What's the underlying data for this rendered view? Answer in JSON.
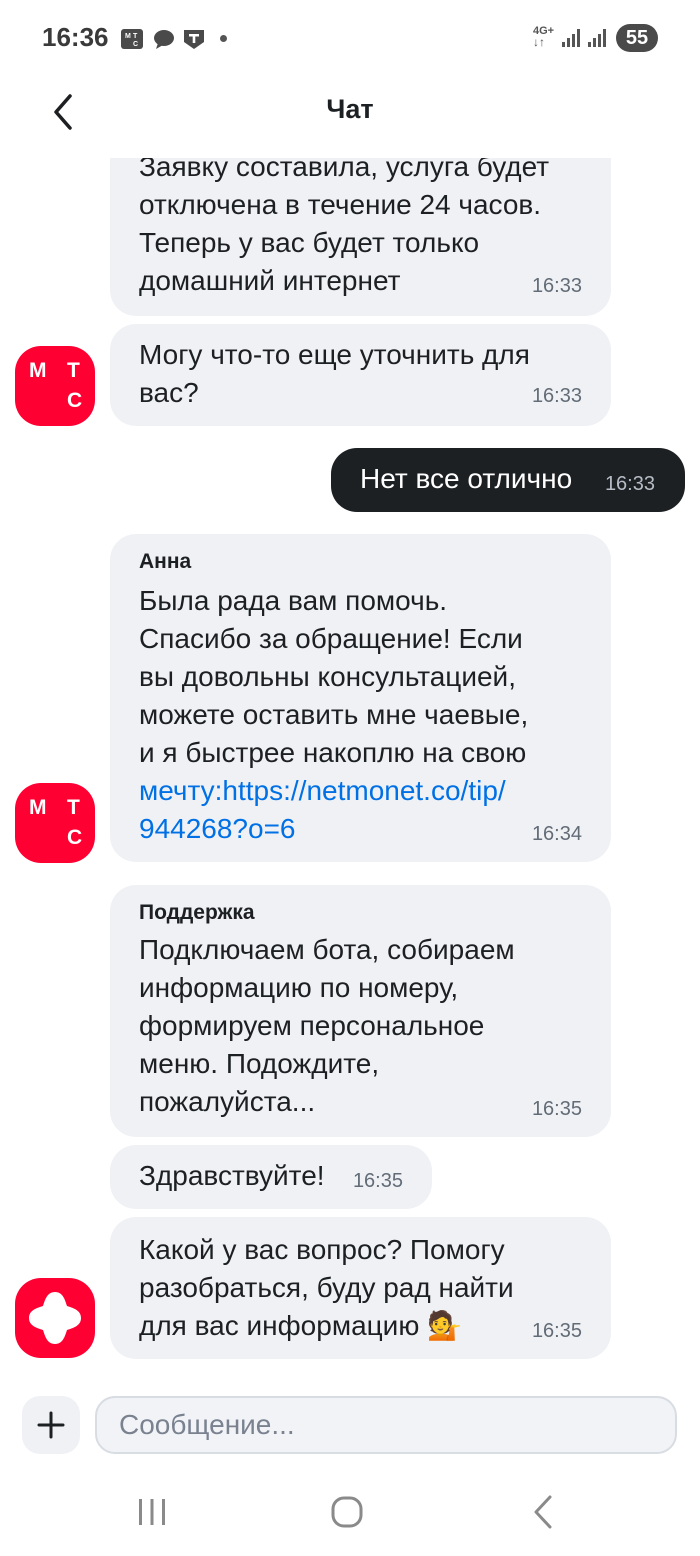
{
  "status_bar": {
    "time": "16:36",
    "network": "4G+",
    "battery": "55"
  },
  "header": {
    "title": "Чат"
  },
  "messages": [
    {
      "type": "incoming",
      "lines": [
        "Заявку составила, услуга будет",
        "отключена в течение 24 часов.",
        "Теперь у вас будет только",
        "домашний интернет"
      ],
      "time": "16:33"
    },
    {
      "type": "incoming",
      "avatar_lines": [
        "М",
        "Т",
        "С"
      ],
      "lines": [
        "Могу что-то еще уточнить для",
        "вас?"
      ],
      "time": "16:33"
    },
    {
      "type": "outgoing",
      "text": "Нет все отлично",
      "time": "16:33"
    },
    {
      "type": "incoming",
      "sender": "Анна",
      "avatar_lines": [
        "М",
        "Т",
        "С"
      ],
      "lines": [
        "Была рада вам помочь.",
        "Спасибо за обращение! Если",
        "вы довольны консультацией,",
        "можете оставить мне чаевые,",
        "и я быстрее накоплю на свою"
      ],
      "link_lines": [
        "мечту:https://netmonet.co/tip/",
        "944268?o=6"
      ],
      "time": "16:34"
    },
    {
      "type": "incoming",
      "sender": "Поддержка",
      "lines": [
        "Подключаем бота, собираем",
        "информацию по номеру,",
        "формируем персональное",
        "меню. Подождите,",
        "пожалуйста..."
      ],
      "time": "16:35"
    },
    {
      "type": "incoming",
      "text": "Здравствуйте!",
      "time": "16:35"
    },
    {
      "type": "incoming",
      "lines": [
        "Какой у вас вопрос? Помогу",
        "разобраться, буду рад найти",
        "для вас информацию 💁"
      ],
      "time": "16:35"
    }
  ],
  "input": {
    "placeholder": "Сообщение..."
  },
  "colors": {
    "brand": "#ff0032",
    "bubble_incoming": "#f0f1f5",
    "bubble_outgoing": "#1d2023",
    "link": "#0070e5"
  },
  "icons": {
    "back": "chevron-left-icon",
    "add": "plus-icon",
    "nav_recent": "recent-apps-icon",
    "nav_home": "home-icon",
    "nav_back": "back-icon"
  }
}
